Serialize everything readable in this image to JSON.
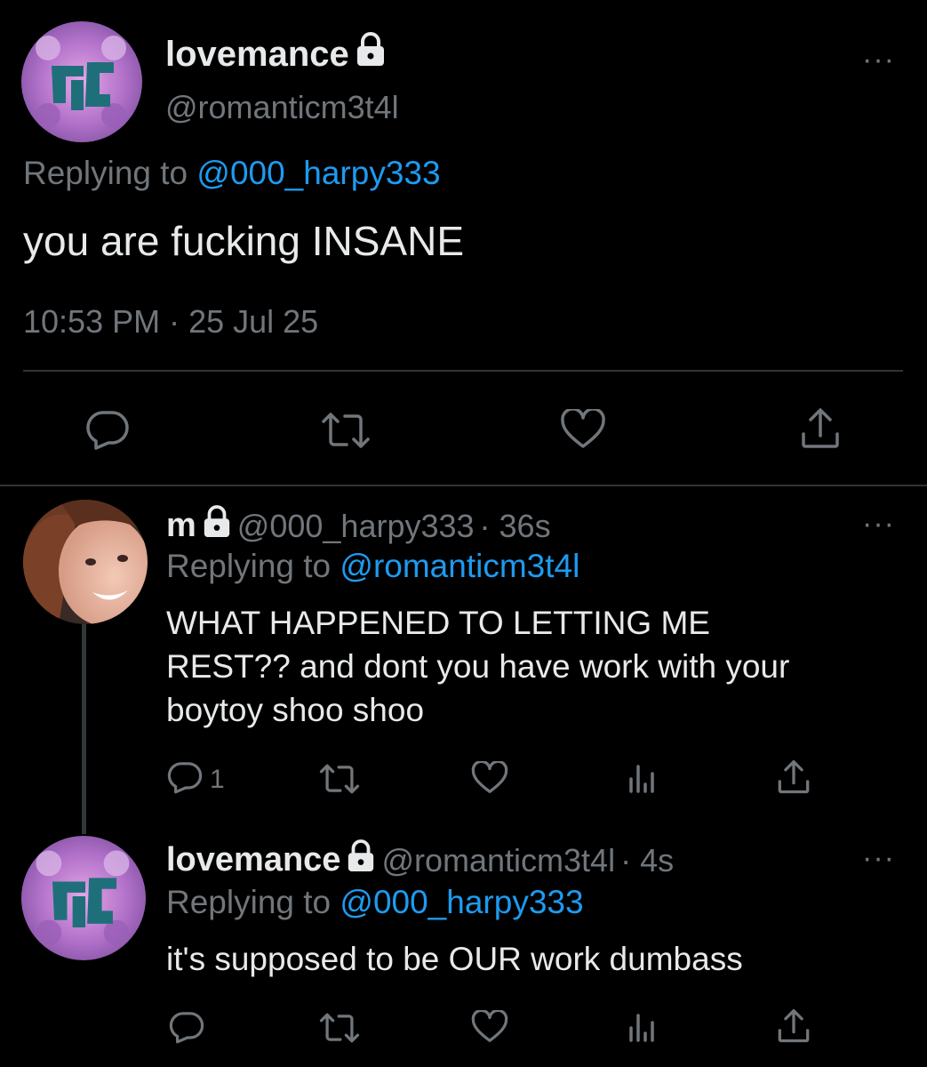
{
  "main_tweet": {
    "display_name": "lovemance",
    "handle": "@romanticm3t4l",
    "replying_label": "Replying to",
    "replying_to": "@000_harpy333",
    "text": "you are fucking INSANE",
    "timestamp": "10:53 PM · 25 Jul 25"
  },
  "reply_1": {
    "display_name": "m",
    "handle": "@000_harpy333",
    "time": "· 36s",
    "replying_label": "Replying to",
    "replying_to": "@romanticm3t4l",
    "text_line1": "WHAT HAPPENED TO LETTING ME",
    "text_line2": "REST?? and dont you have work with your",
    "text_line3": "boytoy shoo shoo",
    "reply_count": "1"
  },
  "reply_2": {
    "display_name": "lovemance",
    "handle": "@romanticm3t4l",
    "time": "· 4s",
    "replying_label": "Replying to",
    "replying_to": "@000_harpy333",
    "text": "it's supposed to be OUR work dumbass"
  },
  "more_label": "···",
  "colors": {
    "background": "#000000",
    "text": "#e7e9ea",
    "secondary": "#71767b",
    "link": "#1d9bf0",
    "divider": "#2f3336"
  }
}
